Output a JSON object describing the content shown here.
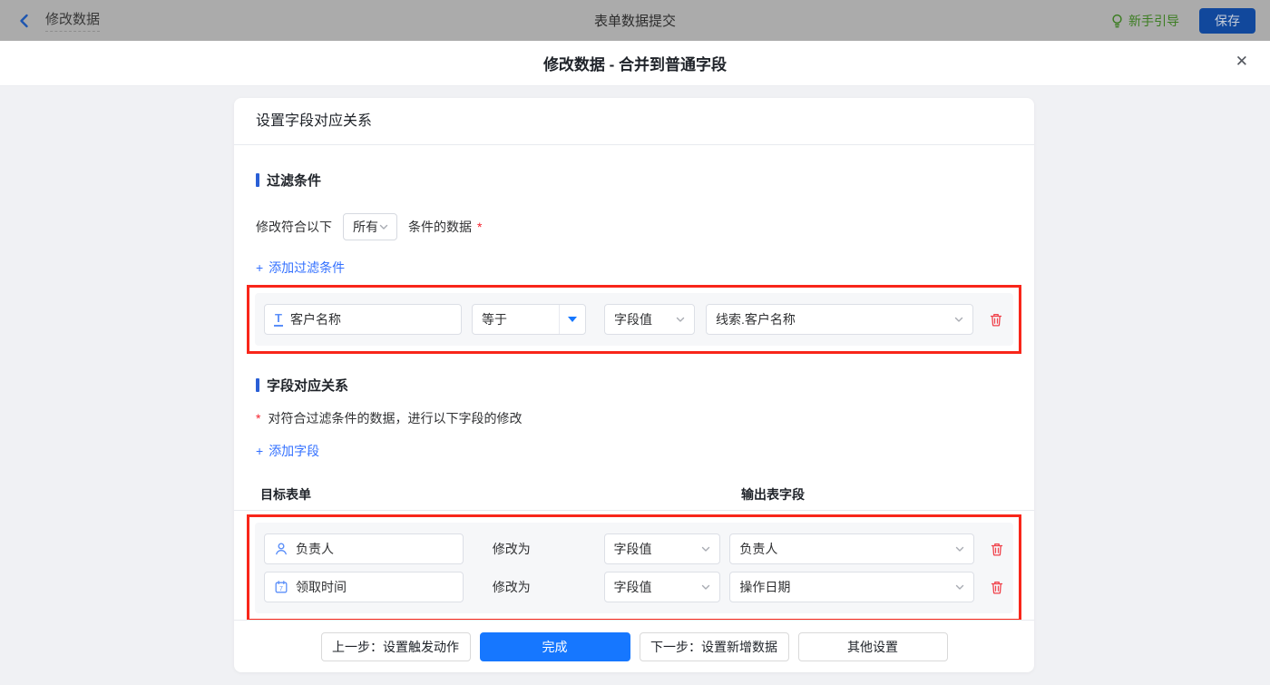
{
  "topbar": {
    "back_label": "修改数据",
    "center_title": "表单数据提交",
    "guide_label": "新手引导",
    "save_label": "保存"
  },
  "modal": {
    "title": "修改数据 - 合并到普通字段",
    "close_glyph": "✕"
  },
  "card": {
    "header": "设置字段对应关系",
    "filter": {
      "title": "过滤条件",
      "prefix": "修改符合以下",
      "scope_value": "所有",
      "suffix": "条件的数据",
      "required_mark": "*",
      "add_plus": "+",
      "add_label": "添加过滤条件",
      "row": {
        "field": "客户名称",
        "field_icon": "text-field-icon",
        "operator": "等于",
        "value_type": "字段值",
        "value": "线索.客户名称"
      }
    },
    "mapping": {
      "title": "字段对应关系",
      "required_mark": "*",
      "desc": "对符合过滤条件的数据，进行以下字段的修改",
      "add_plus": "+",
      "add_label": "添加字段",
      "col_target": "目标表单",
      "col_output": "输出表字段",
      "rows": [
        {
          "field": "负责人",
          "field_icon": "user-icon",
          "action": "修改为",
          "value_type": "字段值",
          "value": "负责人"
        },
        {
          "field": "领取时间",
          "field_icon": "calendar-icon",
          "action": "修改为",
          "value_type": "字段值",
          "value": "操作日期"
        }
      ]
    },
    "footer": {
      "prev": "上一步：设置触发动作",
      "done": "完成",
      "next": "下一步：设置新增数据",
      "other": "其他设置"
    }
  },
  "icons": {
    "text_field_glyph": "T",
    "calendar_day": "7"
  },
  "colors": {
    "accent_blue": "#1677ff",
    "link_blue": "#3370ff",
    "section_bar_blue": "#2a5fd6",
    "annotation_red": "#f8261a",
    "danger_red": "#f0414a",
    "field_icon_blue": "#5b8ff9",
    "guide_green": "#3c7d22",
    "topbar_gray": "#ababab",
    "page_bg": "#f0f1f4",
    "row_bg": "#f6f7f9"
  }
}
